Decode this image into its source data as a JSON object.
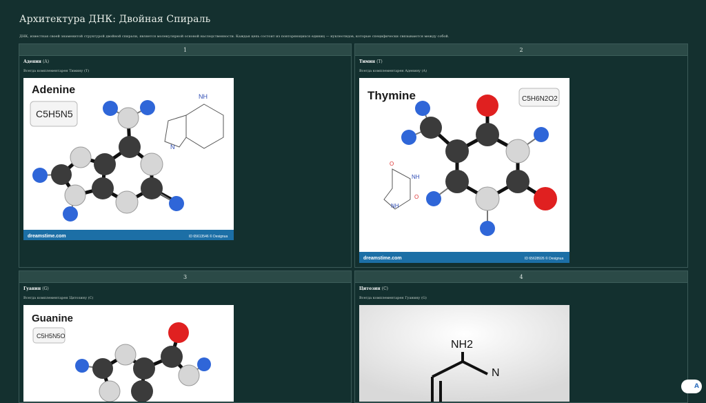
{
  "page": {
    "title": "Архитектура ДНК: Двойная Спираль",
    "subtitle": "ДНК, известная своей знаменитой структурой двойной спирали, является молекулярной основой наследственности. Каждая цепь состоит из повторяющихся единиц — нуклеотидов, которые специфически связываются между собой."
  },
  "cards": [
    {
      "number": "1",
      "name": "Аденин",
      "symbol": "(A)",
      "description": "Всегда комплементарен Тимину (T)",
      "image": {
        "heading": "Adenine",
        "formula": "C5H5N5",
        "watermark": "dreamstime.com",
        "id_text": "ID 65613546 © Designua"
      }
    },
    {
      "number": "2",
      "name": "Тимин",
      "symbol": "(T)",
      "description": "Всегда комплементарен Аденину (A)",
      "image": {
        "heading": "Thymine",
        "formula": "C5H6N2O2",
        "watermark": "dreamstime.com",
        "id_text": "ID 65628926 © Designua"
      }
    },
    {
      "number": "3",
      "name": "Гуанин",
      "symbol": "(G)",
      "description": "Всегда комплементарен Цитозину (C)",
      "image": {
        "heading": "Guanine",
        "formula": "C5H5N5O"
      }
    },
    {
      "number": "4",
      "name": "Цитозин",
      "symbol": "(C)",
      "description": "Всегда комплементарен Гуанину (G)",
      "image": {
        "label_top": "NH2",
        "label_n": "N"
      }
    }
  ],
  "floating_button": {
    "label": "A"
  },
  "colors": {
    "background": "#14302f",
    "card_header": "#2b4a47",
    "atom_carbon": "#3a3a3a",
    "atom_nitrogen": "#d8d8d8",
    "atom_hydrogen": "#2f66d8",
    "atom_oxygen": "#e02020",
    "footer_bar": "#1c6fa6"
  }
}
